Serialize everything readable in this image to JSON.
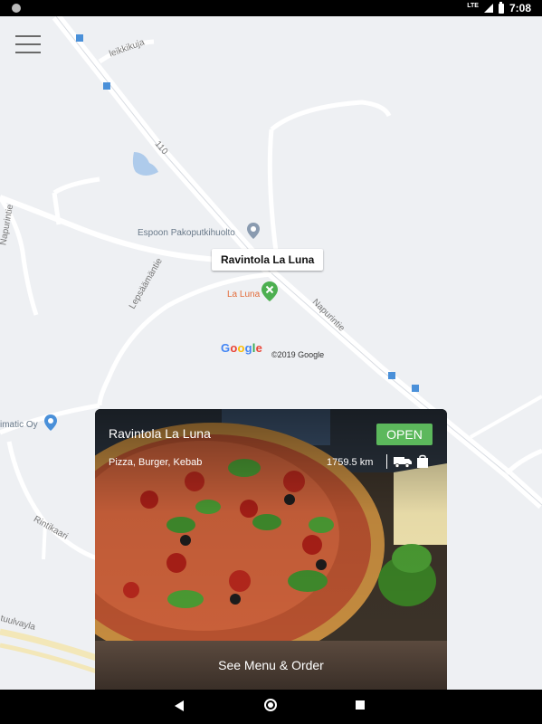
{
  "status_bar": {
    "lte": "LTE",
    "time": "7:08"
  },
  "map": {
    "street_labels": [
      "leikkikuja",
      "110",
      "Napurintie",
      "Lepsäämäntie",
      "Napurintie",
      "Rintikaari",
      "tuulvayla"
    ],
    "poi_pakoputki": "Espoon Pakoputkihuolto",
    "marker_title": "Ravintola La Luna",
    "marker_label": "La Luna",
    "left_poi": "imatic Oy",
    "google": [
      "G",
      "o",
      "o",
      "g",
      "l",
      "e"
    ],
    "google_colors": [
      "#4285F4",
      "#EA4335",
      "#FBBC05",
      "#4285F4",
      "#34A853",
      "#EA4335"
    ],
    "copyright": "©2019 Google"
  },
  "restaurant_card": {
    "name": "Ravintola La Luna",
    "status": "OPEN",
    "status_color": "#5cb85c",
    "cuisine": "Pizza, Burger, Kebab",
    "distance": "1759.5 km",
    "delivery_icon": "truck-icon",
    "pickup_icon": "shopping-bag-icon",
    "cta": "See Menu & Order"
  },
  "nav_bar": {
    "back": "back-icon",
    "home": "home-icon",
    "recent": "recent-apps-icon"
  }
}
